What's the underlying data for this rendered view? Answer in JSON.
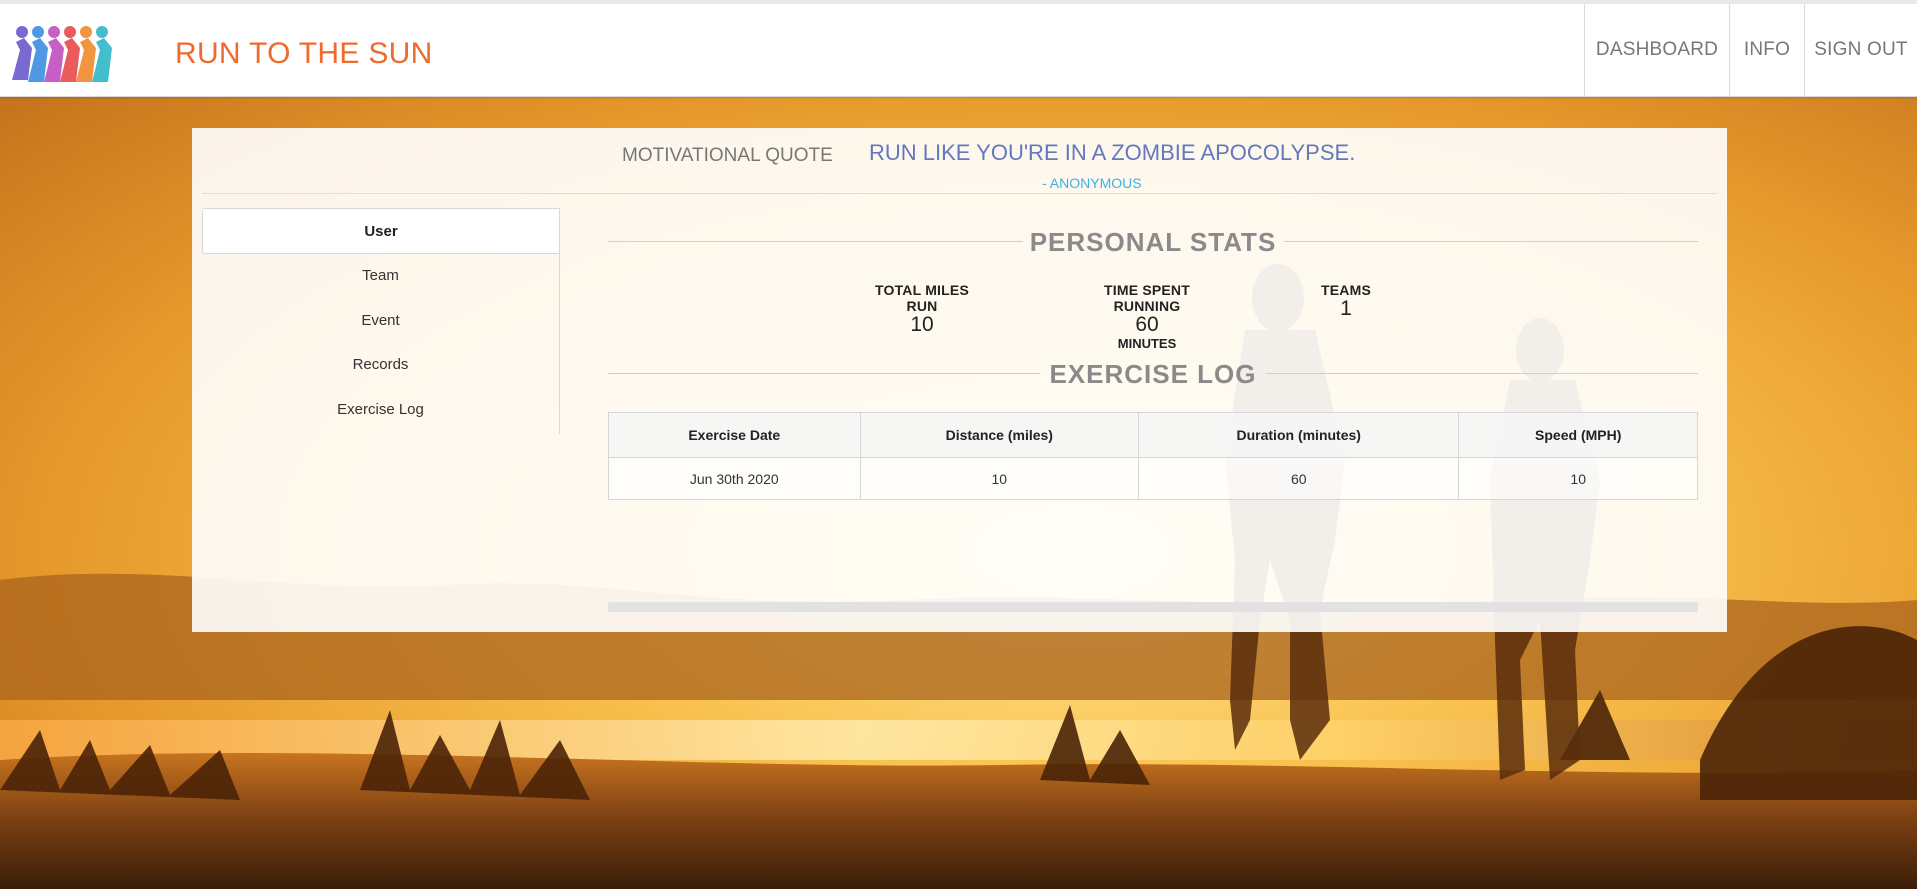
{
  "app": {
    "brand": "RUN TO THE SUN",
    "colors": {
      "brand": "#ef6a2d",
      "quote": "#6478bd",
      "author": "#3bb3e6"
    }
  },
  "nav": {
    "items": [
      {
        "label": "DASHBOARD"
      },
      {
        "label": "INFO"
      },
      {
        "label": "SIGN OUT"
      }
    ]
  },
  "quote": {
    "label": "MOTIVATIONAL QUOTE",
    "text": "RUN LIKE YOU'RE IN A ZOMBIE APOCOLYPSE.",
    "author": "- ANONYMOUS"
  },
  "sidebar": {
    "items": [
      {
        "label": "User",
        "active": true
      },
      {
        "label": "Team"
      },
      {
        "label": "Event"
      },
      {
        "label": "Records"
      },
      {
        "label": "Exercise Log"
      }
    ]
  },
  "personal_stats": {
    "title": "PERSONAL STATS",
    "miles": {
      "label": "TOTAL MILES RUN",
      "value": "10"
    },
    "time": {
      "label": "TIME SPENT RUNNING",
      "value": "60",
      "unit": "MINUTES"
    },
    "teams": {
      "label": "TEAMS",
      "value": "1"
    }
  },
  "exercise_log": {
    "title": "EXERCISE LOG",
    "columns": [
      "Exercise Date",
      "Distance (miles)",
      "Duration (minutes)",
      "Speed (MPH)"
    ],
    "rows": [
      [
        "Jun 30th 2020",
        "10",
        "60",
        "10"
      ]
    ]
  }
}
